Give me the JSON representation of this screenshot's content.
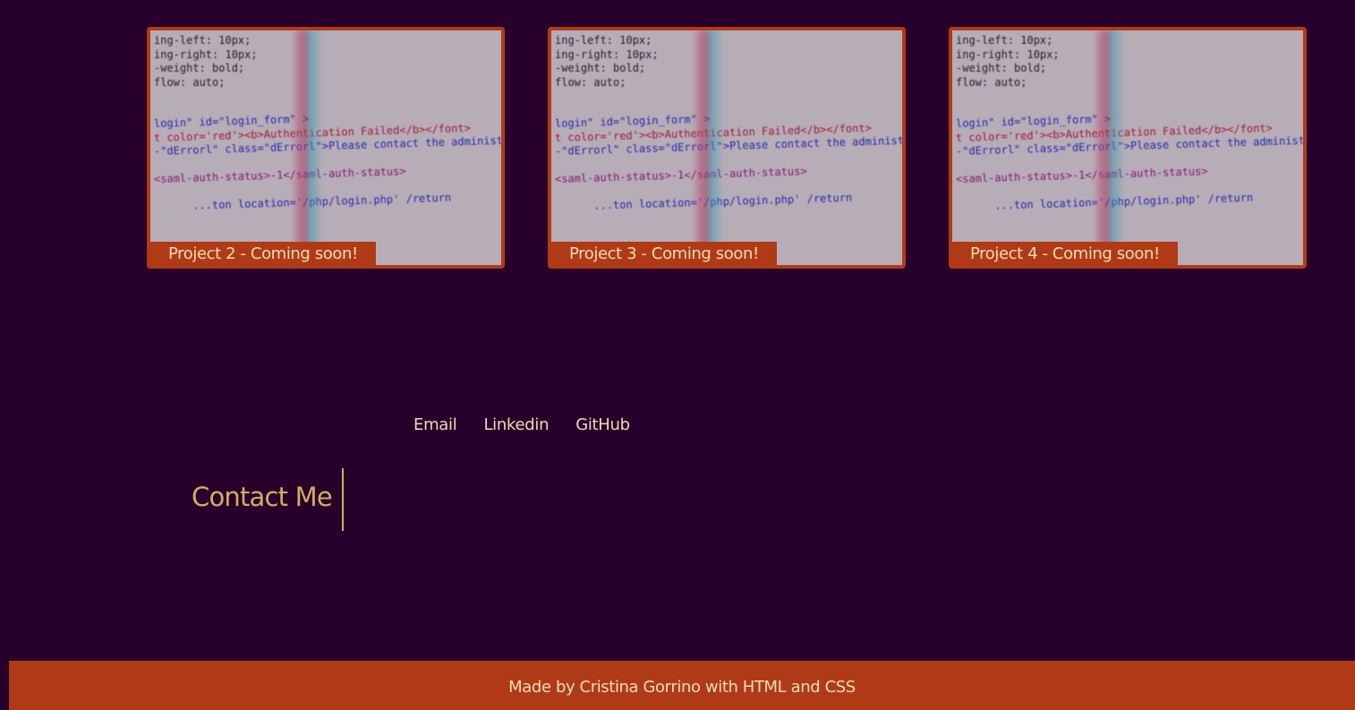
{
  "projects": [
    {
      "label": "Project 2 - Coming soon!"
    },
    {
      "label": "Project 3 - Coming soon!"
    },
    {
      "label": "Project 4 - Coming soon!"
    }
  ],
  "project_image": {
    "lines": [
      "ing-left: 10px;",
      "ing-right: 10px;",
      "-weight: bold;",
      "flow: auto;",
      "",
      "",
      "login\" id=\"login_form\" >",
      "t color='red'><b>Authentication Failed</b></font>",
      "-\"dErrorl\" class=\"dErrorl\">Please contact the administ",
      "",
      "<saml-auth-status>-1</saml-auth-status>",
      "",
      "      ...ton location='/php/login.php' /return"
    ]
  },
  "contact": {
    "links": [
      "Email",
      "Linkedin",
      "GitHub"
    ],
    "title": "Contact Me"
  },
  "footer": {
    "text": "Made by Cristina Gorrino with HTML and CSS"
  },
  "colors": {
    "background": "#28002c",
    "accent": "#b13a16",
    "title": "#d2ad63",
    "link": "#efd9b4"
  }
}
